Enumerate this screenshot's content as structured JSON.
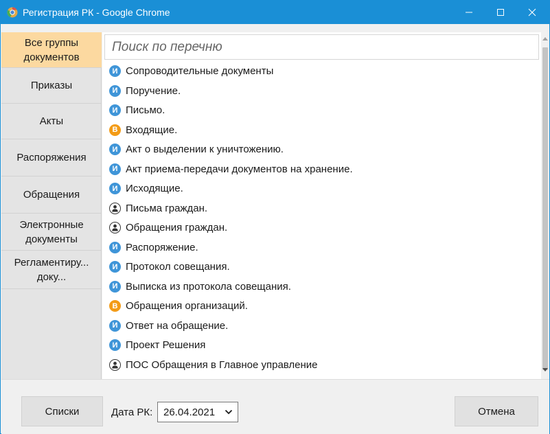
{
  "window": {
    "title": "Регистрация РК - Google Chrome",
    "accent_color": "#1a8fd6",
    "icons": {
      "app": "chrome-icon",
      "minimize": "minimize-icon",
      "maximize": "maximize-icon",
      "close": "close-icon"
    }
  },
  "sidebar": {
    "items": [
      {
        "label": "Все группы документов",
        "active": true
      },
      {
        "label": "Приказы"
      },
      {
        "label": "Акты"
      },
      {
        "label": "Распоряжения"
      },
      {
        "label": "Обращения"
      },
      {
        "label": "Электронные документы"
      },
      {
        "label": "Регламентиру... доку..."
      }
    ],
    "active_color": "#fcd9a0"
  },
  "search": {
    "placeholder": "Поиск по перечню",
    "value": ""
  },
  "badges": {
    "i": {
      "letter": "И",
      "color": "#3f95d8"
    },
    "b": {
      "letter": "В",
      "color": "#f39b16"
    },
    "p": {
      "icon": "person-icon"
    }
  },
  "documents": [
    {
      "type": "i",
      "label": "Сопроводительные документы"
    },
    {
      "type": "i",
      "label": "Поручение."
    },
    {
      "type": "i",
      "label": "Письмо."
    },
    {
      "type": "b",
      "label": "Входящие."
    },
    {
      "type": "i",
      "label": "Акт о выделении к уничтожению."
    },
    {
      "type": "i",
      "label": "Акт приема-передачи документов на хранение."
    },
    {
      "type": "i",
      "label": "Исходящие."
    },
    {
      "type": "p",
      "label": "Письма граждан."
    },
    {
      "type": "p",
      "label": "Обращения граждан."
    },
    {
      "type": "i",
      "label": "Распоряжение."
    },
    {
      "type": "i",
      "label": "Протокол совещания."
    },
    {
      "type": "i",
      "label": "Выписка из протокола совещания."
    },
    {
      "type": "b",
      "label": "Обращения организаций."
    },
    {
      "type": "i",
      "label": "Ответ на обращение."
    },
    {
      "type": "i",
      "label": "Проект Решения"
    },
    {
      "type": "p",
      "label": "ПОС Обращения в Главное управление"
    }
  ],
  "footer": {
    "lists_button": "Списки",
    "date_label": "Дата РК:",
    "date_value": "26.04.2021",
    "cancel_button": "Отмена"
  }
}
